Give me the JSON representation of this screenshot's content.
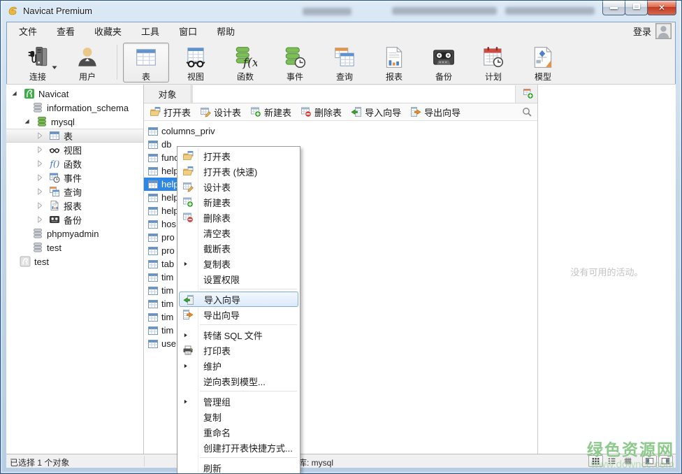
{
  "window": {
    "title": "Navicat Premium"
  },
  "title_bar": {
    "buttons": [
      "minimize",
      "maximize",
      "close"
    ]
  },
  "menu_bar": {
    "items": [
      "文件",
      "查看",
      "收藏夹",
      "工具",
      "窗口",
      "帮助"
    ],
    "login_label": "登录"
  },
  "toolbar": {
    "groups": [
      [
        {
          "id": "connect",
          "label": "连接",
          "icon": "connection32",
          "caret": true
        },
        {
          "id": "user",
          "label": "用户",
          "icon": "user32"
        }
      ],
      [
        {
          "id": "tables",
          "label": "表",
          "icon": "table32",
          "active": true
        },
        {
          "id": "views",
          "label": "视图",
          "icon": "view32"
        },
        {
          "id": "functions",
          "label": "函数",
          "icon": "func32"
        },
        {
          "id": "events",
          "label": "事件",
          "icon": "event32"
        },
        {
          "id": "queries",
          "label": "查询",
          "icon": "query32"
        },
        {
          "id": "reports",
          "label": "报表",
          "icon": "report32"
        },
        {
          "id": "backups",
          "label": "备份",
          "icon": "backup32"
        },
        {
          "id": "schedule",
          "label": "计划",
          "icon": "schedule32"
        },
        {
          "id": "models",
          "label": "模型",
          "icon": "model32"
        }
      ]
    ]
  },
  "sidebar": {
    "items": [
      {
        "id": "navicat",
        "label": "Navicat",
        "icon": "navicat",
        "depth": 0,
        "arrow": "expanded"
      },
      {
        "id": "information-schema",
        "label": "information_schema",
        "icon": "db-grey",
        "depth": 1
      },
      {
        "id": "mysql",
        "label": "mysql",
        "icon": "db-green",
        "depth": 1,
        "arrow": "expanded"
      },
      {
        "id": "tables",
        "label": "表",
        "icon": "table",
        "depth": 2,
        "arrow": "collapsed",
        "selected": true
      },
      {
        "id": "views",
        "label": "视图",
        "icon": "view",
        "depth": 2,
        "arrow": "collapsed"
      },
      {
        "id": "functions",
        "label": "函数",
        "icon": "func",
        "depth": 2,
        "arrow": "collapsed"
      },
      {
        "id": "events",
        "label": "事件",
        "icon": "event",
        "depth": 2,
        "arrow": "collapsed"
      },
      {
        "id": "queries",
        "label": "查询",
        "icon": "query",
        "depth": 2,
        "arrow": "collapsed"
      },
      {
        "id": "reports",
        "label": "报表",
        "icon": "report",
        "depth": 2,
        "arrow": "collapsed"
      },
      {
        "id": "backups",
        "label": "备份",
        "icon": "backup",
        "depth": 2,
        "arrow": "collapsed"
      },
      {
        "id": "phpmyadmin",
        "label": "phpmyadmin",
        "icon": "db-grey",
        "depth": 1
      },
      {
        "id": "test-db",
        "label": "test",
        "icon": "db-grey",
        "depth": 1
      },
      {
        "id": "test-conn",
        "label": "test",
        "icon": "conn-grey",
        "depth": 0
      }
    ]
  },
  "main": {
    "tab_label": "对象",
    "object_toolbar": [
      {
        "id": "open-table",
        "label": "打开表",
        "icon": "open-table"
      },
      {
        "id": "design-table",
        "label": "设计表",
        "icon": "design-table"
      },
      {
        "id": "new-table",
        "label": "新建表",
        "icon": "new-table"
      },
      {
        "id": "delete-table",
        "label": "删除表",
        "icon": "delete-table"
      },
      {
        "id": "import-wizard",
        "label": "导入向导",
        "icon": "import"
      },
      {
        "id": "export-wizard",
        "label": "导出向导",
        "icon": "export"
      }
    ],
    "tables": [
      "columns_priv",
      "db",
      "func",
      "help",
      "help",
      "help",
      "help",
      "hos",
      "pro",
      "pro",
      "tab",
      "tim",
      "tim",
      "tim",
      "tim",
      "tim",
      "use"
    ],
    "selected_index": 4
  },
  "context_menu": {
    "items": [
      {
        "id": "open-table",
        "label": "打开表",
        "icon": "open-table"
      },
      {
        "id": "open-table-fast",
        "label": "打开表 (快速)",
        "icon": "open-table"
      },
      {
        "id": "design-table",
        "label": "设计表",
        "icon": "design-table"
      },
      {
        "id": "new-table",
        "label": "新建表",
        "icon": "new-table"
      },
      {
        "id": "delete-table",
        "label": "删除表",
        "icon": "delete-table"
      },
      {
        "id": "empty-table",
        "label": "清空表"
      },
      {
        "id": "truncate-table",
        "label": "截断表"
      },
      {
        "id": "duplicate-table",
        "label": "复制表",
        "submenu": true
      },
      {
        "id": "set-permissions",
        "label": "设置权限"
      },
      {
        "sep": true
      },
      {
        "id": "import-wizard",
        "label": "导入向导",
        "icon": "import",
        "highlighted": true
      },
      {
        "id": "export-wizard",
        "label": "导出向导",
        "icon": "export"
      },
      {
        "sep": true
      },
      {
        "id": "dump-sql",
        "label": "转储 SQL 文件",
        "submenu": true
      },
      {
        "id": "print-table",
        "label": "打印表",
        "icon": "print"
      },
      {
        "id": "maintain",
        "label": "维护",
        "submenu": true
      },
      {
        "id": "reverse-to-model",
        "label": "逆向表到模型..."
      },
      {
        "sep": true
      },
      {
        "id": "manage-group",
        "label": "管理组",
        "submenu": true
      },
      {
        "id": "copy",
        "label": "复制"
      },
      {
        "id": "rename",
        "label": "重命名"
      },
      {
        "id": "create-shortcut",
        "label": "创建打开表快捷方式..."
      },
      {
        "sep": true
      },
      {
        "id": "refresh",
        "label": "刷新"
      }
    ]
  },
  "right_panel": {
    "empty_text": "没有可用的活动。"
  },
  "status_bar": {
    "left_text": "已选择 1 个对象",
    "db_text": "数据库: mysql",
    "view_buttons": [
      {
        "id": "view-grid",
        "icon": "view-grid",
        "pressed": true
      },
      {
        "id": "view-list",
        "icon": "view-list"
      },
      {
        "id": "view-detail",
        "icon": "view-detail"
      },
      {
        "id": "pane-left",
        "icon": "pane-left",
        "framed": true
      },
      {
        "id": "pane-right",
        "icon": "pane-right",
        "framed": true
      }
    ]
  },
  "watermark": {
    "line1": "绿色资源网",
    "line2": "www.downcc.com"
  },
  "colors": {
    "selection_blue": "#2e86e5",
    "menu_highlight_border": "#84acdd",
    "green": "#3fae49",
    "orange": "#ef8b1f",
    "red": "#d9403e",
    "watermark_green": "#8bca8b",
    "titlebar_blue": "#c2d6ea"
  }
}
